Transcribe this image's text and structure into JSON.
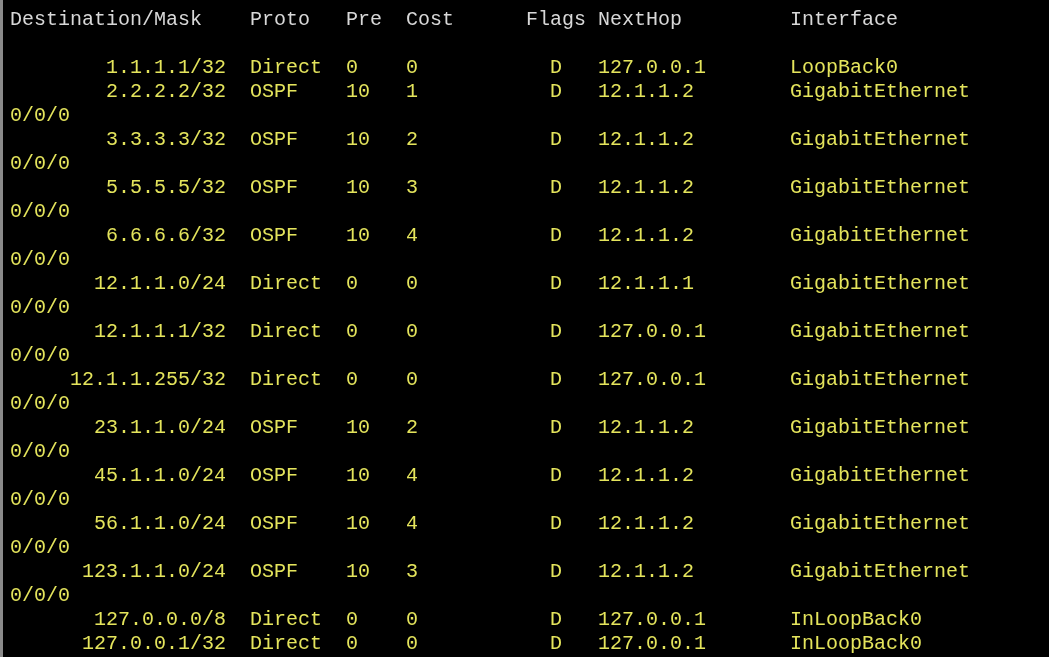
{
  "header": [
    "Destination/Mask",
    "Proto",
    "Pre",
    "Cost",
    "Flags",
    "NextHop",
    "Interface"
  ],
  "routes": [
    {
      "destination": "1.1.1.1/32",
      "proto": "Direct",
      "pre": "0",
      "cost": "0",
      "flags": "D",
      "nexthop": "127.0.0.1",
      "interface": "LoopBack0"
    },
    {
      "destination": "2.2.2.2/32",
      "proto": "OSPF",
      "pre": "10",
      "cost": "1",
      "flags": "D",
      "nexthop": "12.1.1.2",
      "interface": "GigabitEthernet",
      "interface_continued": "0/0/0"
    },
    {
      "destination": "3.3.3.3/32",
      "proto": "OSPF",
      "pre": "10",
      "cost": "2",
      "flags": "D",
      "nexthop": "12.1.1.2",
      "interface": "GigabitEthernet",
      "interface_continued": "0/0/0"
    },
    {
      "destination": "5.5.5.5/32",
      "proto": "OSPF",
      "pre": "10",
      "cost": "3",
      "flags": "D",
      "nexthop": "12.1.1.2",
      "interface": "GigabitEthernet",
      "interface_continued": "0/0/0"
    },
    {
      "destination": "6.6.6.6/32",
      "proto": "OSPF",
      "pre": "10",
      "cost": "4",
      "flags": "D",
      "nexthop": "12.1.1.2",
      "interface": "GigabitEthernet",
      "interface_continued": "0/0/0"
    },
    {
      "destination": "12.1.1.0/24",
      "proto": "Direct",
      "pre": "0",
      "cost": "0",
      "flags": "D",
      "nexthop": "12.1.1.1",
      "interface": "GigabitEthernet",
      "interface_continued": "0/0/0"
    },
    {
      "destination": "12.1.1.1/32",
      "proto": "Direct",
      "pre": "0",
      "cost": "0",
      "flags": "D",
      "nexthop": "127.0.0.1",
      "interface": "GigabitEthernet",
      "interface_continued": "0/0/0"
    },
    {
      "destination": "12.1.1.255/32",
      "proto": "Direct",
      "pre": "0",
      "cost": "0",
      "flags": "D",
      "nexthop": "127.0.0.1",
      "interface": "GigabitEthernet",
      "interface_continued": "0/0/0"
    },
    {
      "destination": "23.1.1.0/24",
      "proto": "OSPF",
      "pre": "10",
      "cost": "2",
      "flags": "D",
      "nexthop": "12.1.1.2",
      "interface": "GigabitEthernet",
      "interface_continued": "0/0/0"
    },
    {
      "destination": "45.1.1.0/24",
      "proto": "OSPF",
      "pre": "10",
      "cost": "4",
      "flags": "D",
      "nexthop": "12.1.1.2",
      "interface": "GigabitEthernet",
      "interface_continued": "0/0/0"
    },
    {
      "destination": "56.1.1.0/24",
      "proto": "OSPF",
      "pre": "10",
      "cost": "4",
      "flags": "D",
      "nexthop": "12.1.1.2",
      "interface": "GigabitEthernet",
      "interface_continued": "0/0/0"
    },
    {
      "destination": "123.1.1.0/24",
      "proto": "OSPF",
      "pre": "10",
      "cost": "3",
      "flags": "D",
      "nexthop": "12.1.1.2",
      "interface": "GigabitEthernet",
      "interface_continued": "0/0/0"
    },
    {
      "destination": "127.0.0.0/8",
      "proto": "Direct",
      "pre": "0",
      "cost": "0",
      "flags": "D",
      "nexthop": "127.0.0.1",
      "interface": "InLoopBack0"
    },
    {
      "destination": "127.0.0.1/32",
      "proto": "Direct",
      "pre": "0",
      "cost": "0",
      "flags": "D",
      "nexthop": "127.0.0.1",
      "interface": "InLoopBack0"
    }
  ]
}
